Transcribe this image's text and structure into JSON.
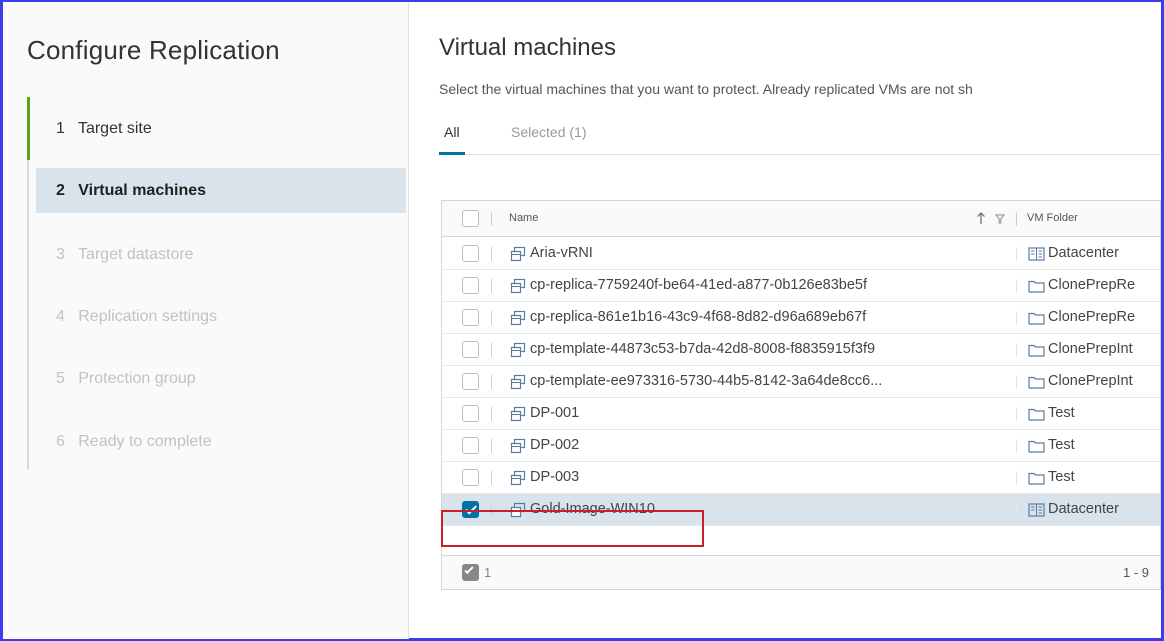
{
  "wizard": {
    "title": "Configure Replication",
    "steps": [
      {
        "number": "1",
        "label": "Target site",
        "state": "done"
      },
      {
        "number": "2",
        "label": "Virtual machines",
        "state": "current"
      },
      {
        "number": "3",
        "label": "Target datastore",
        "state": "upcoming"
      },
      {
        "number": "4",
        "label": "Replication settings",
        "state": "upcoming"
      },
      {
        "number": "5",
        "label": "Protection group",
        "state": "upcoming"
      },
      {
        "number": "6",
        "label": "Ready to complete",
        "state": "upcoming"
      }
    ]
  },
  "main": {
    "title": "Virtual machines",
    "description": "Select the virtual machines that you want to protect. Already replicated VMs are not sh",
    "tabs": [
      {
        "label": "All",
        "active": true
      },
      {
        "label": "Selected (1)",
        "active": false
      }
    ],
    "grid": {
      "columns": {
        "name": "Name",
        "folder": "VM Folder",
        "sort_icon": "arrow-up-icon",
        "filter_icon": "filter-icon"
      },
      "rows": [
        {
          "name": "Aria-vRNI",
          "folder": "Datacenter",
          "folder_icon": "datacenter-icon",
          "checked": false
        },
        {
          "name": "cp-replica-7759240f-be64-41ed-a877-0b126e83be5f",
          "folder": "ClonePrepRe",
          "folder_icon": "folder-icon",
          "checked": false
        },
        {
          "name": "cp-replica-861e1b16-43c9-4f68-8d82-d96a689eb67f",
          "folder": "ClonePrepRe",
          "folder_icon": "folder-icon",
          "checked": false
        },
        {
          "name": "cp-template-44873c53-b7da-42d8-8008-f8835915f3f9",
          "folder": "ClonePrepInt",
          "folder_icon": "folder-icon",
          "checked": false
        },
        {
          "name": "cp-template-ee973316-5730-44b5-8142-3a64de8cc6...",
          "folder": "ClonePrepInt",
          "folder_icon": "folder-icon",
          "checked": false
        },
        {
          "name": "DP-001",
          "folder": "Test",
          "folder_icon": "folder-icon",
          "checked": false
        },
        {
          "name": "DP-002",
          "folder": "Test",
          "folder_icon": "folder-icon",
          "checked": false
        },
        {
          "name": "DP-003",
          "folder": "Test",
          "folder_icon": "folder-icon",
          "checked": false
        },
        {
          "name": "Gold-Image-WIN10",
          "folder": "Datacenter",
          "folder_icon": "datacenter-icon",
          "checked": true
        }
      ],
      "footer": {
        "selected_count": "1",
        "pagination": "1 - 9"
      }
    }
  },
  "colors": {
    "accent": "#0072a3",
    "active_step_bar": "#5aa220",
    "selected_row": "#d8e3eb",
    "highlight_box": "#c8202b",
    "frame_border": "#3d3df0"
  }
}
